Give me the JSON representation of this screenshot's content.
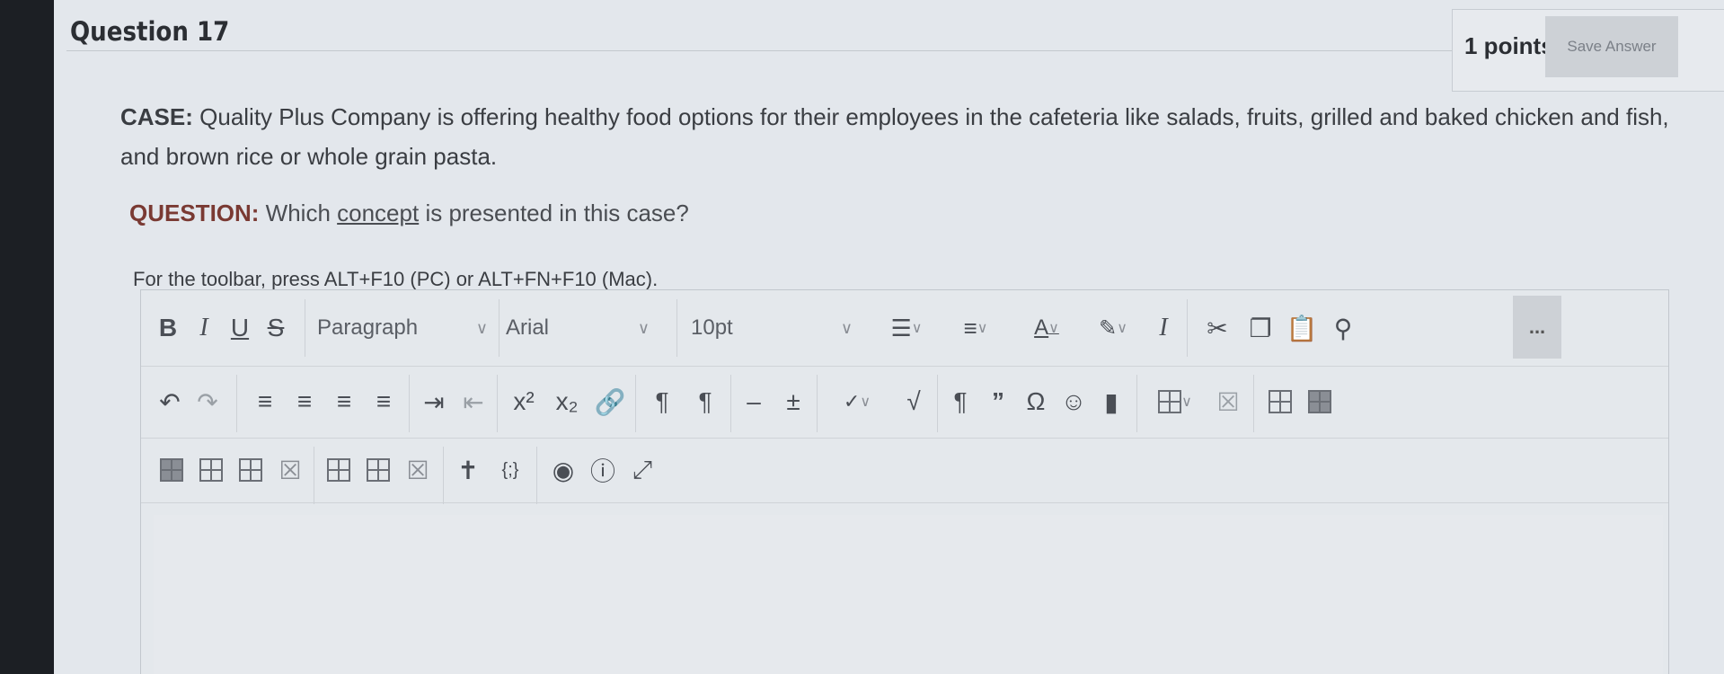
{
  "question": {
    "title": "Question 17",
    "points": "1 points",
    "save_label": "Save Answer"
  },
  "case": {
    "lead": "CASE:",
    "text": " Quality Plus Company is offering healthy food options for their employees in the cafeteria like salads, fruits, grilled and baked chicken and fish, and brown rice or whole grain pasta."
  },
  "prompt": {
    "lead": "QUESTION:",
    "before": " Which ",
    "underlined": "concept",
    "after": " is presented in this case?"
  },
  "editor": {
    "hint": "For the toolbar, press ALT+F10 (PC) or ALT+FN+F10 (Mac).",
    "bold": "B",
    "italic": "I",
    "underline": "U",
    "strike": "S",
    "block_format": "Paragraph",
    "font_family": "Arial",
    "font_size": "10pt",
    "more": "..."
  }
}
